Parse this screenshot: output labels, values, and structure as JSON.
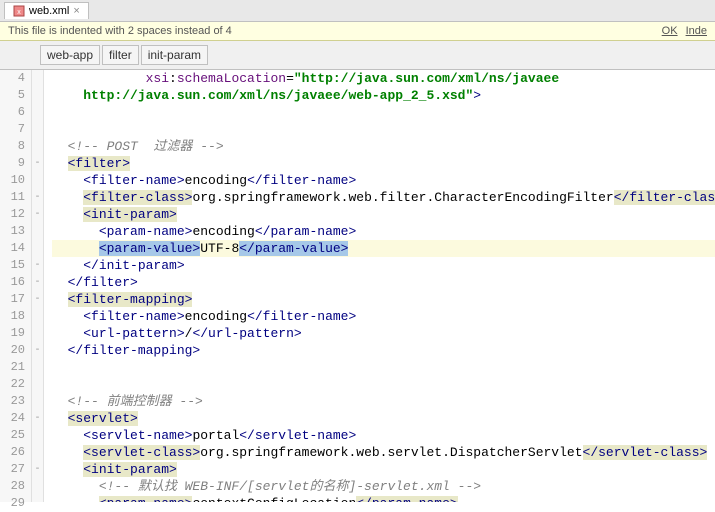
{
  "tab": {
    "filename": "web.xml",
    "close": "×"
  },
  "notice": {
    "text": "This file is indented with 2 spaces instead of 4",
    "ok": "OK",
    "inde": "Inde"
  },
  "breadcrumb": [
    "web-app",
    "filter",
    "init-param"
  ],
  "gutter_start": 4,
  "gutter_end": 29,
  "fold_marks": {
    "9": "-",
    "11": "-",
    "12": "-",
    "15": "-",
    "16": "-",
    "17": "-",
    "20": "-",
    "24": "-",
    "27": "-"
  },
  "code": {
    "4": {
      "indent": 6,
      "parts": [
        [
          "attr",
          "xsi"
        ],
        [
          "txt",
          ":"
        ],
        [
          "attr",
          "schemaLocation"
        ],
        [
          "txt",
          "="
        ],
        [
          "str",
          "\"http://java.sun.com/xml/ns/javaee"
        ]
      ]
    },
    "5": {
      "indent": 2,
      "parts": [
        [
          "str",
          "http://java.sun.com/xml/ns/javaee/web-app_2_5.xsd\""
        ],
        [
          "tag",
          ">"
        ]
      ]
    },
    "6": {
      "indent": 0,
      "parts": []
    },
    "7": {
      "indent": 0,
      "parts": []
    },
    "8": {
      "indent": 1,
      "parts": [
        [
          "cmt",
          "<!-- POST  过滤器 -->"
        ]
      ]
    },
    "9": {
      "indent": 1,
      "hl": true,
      "parts": [
        [
          "tag",
          "<filter>"
        ]
      ]
    },
    "10": {
      "indent": 2,
      "parts": [
        [
          "tag",
          "<filter-name>"
        ],
        [
          "txt",
          "encoding"
        ],
        [
          "tag",
          "</filter-name>"
        ]
      ]
    },
    "11": {
      "indent": 2,
      "hl": true,
      "parts": [
        [
          "tag",
          "<filter-class>"
        ],
        [
          "txt",
          "org.springframework.web.filter.CharacterEncodingFilter"
        ],
        [
          "tag",
          "</filter-class>"
        ]
      ]
    },
    "12": {
      "indent": 2,
      "hl": true,
      "parts": [
        [
          "tag",
          "<init-param>"
        ]
      ]
    },
    "13": {
      "indent": 3,
      "parts": [
        [
          "tag",
          "<param-name>"
        ],
        [
          "txt",
          "encoding"
        ],
        [
          "tag",
          "</param-name>"
        ]
      ]
    },
    "14": {
      "indent": 3,
      "cur": true,
      "sel": true,
      "parts": [
        [
          "tag",
          "<param-value>"
        ],
        [
          "txt",
          "UTF-8"
        ],
        [
          "tag",
          "</param-value>"
        ]
      ]
    },
    "15": {
      "indent": 2,
      "parts": [
        [
          "tag",
          "</init-param>"
        ]
      ]
    },
    "16": {
      "indent": 1,
      "parts": [
        [
          "tag",
          "</filter>"
        ]
      ]
    },
    "17": {
      "indent": 1,
      "hl": true,
      "parts": [
        [
          "tag",
          "<filter-mapping>"
        ]
      ]
    },
    "18": {
      "indent": 2,
      "parts": [
        [
          "tag",
          "<filter-name>"
        ],
        [
          "txt",
          "encoding"
        ],
        [
          "tag",
          "</filter-name>"
        ]
      ]
    },
    "19": {
      "indent": 2,
      "parts": [
        [
          "tag",
          "<url-pattern>"
        ],
        [
          "txt",
          "/"
        ],
        [
          "tag",
          "</url-pattern>"
        ]
      ]
    },
    "20": {
      "indent": 1,
      "parts": [
        [
          "tag",
          "</filter-mapping>"
        ]
      ]
    },
    "21": {
      "indent": 0,
      "parts": []
    },
    "22": {
      "indent": 0,
      "parts": []
    },
    "23": {
      "indent": 1,
      "parts": [
        [
          "cmt",
          "<!-- 前端控制器 -->"
        ]
      ]
    },
    "24": {
      "indent": 1,
      "hl": true,
      "parts": [
        [
          "tag",
          "<servlet>"
        ]
      ]
    },
    "25": {
      "indent": 2,
      "parts": [
        [
          "tag",
          "<servlet-name>"
        ],
        [
          "txt",
          "portal"
        ],
        [
          "tag",
          "</servlet-name>"
        ]
      ]
    },
    "26": {
      "indent": 2,
      "hl": true,
      "parts": [
        [
          "tag",
          "<servlet-class>"
        ],
        [
          "txt",
          "org.springframework.web.servlet.DispatcherServlet"
        ],
        [
          "tag",
          "</servlet-class>"
        ]
      ]
    },
    "27": {
      "indent": 2,
      "hl": true,
      "parts": [
        [
          "tag",
          "<init-param>"
        ]
      ]
    },
    "28": {
      "indent": 3,
      "parts": [
        [
          "cmt",
          "<!-- 默认找 WEB-INF/[servlet的名称]-servlet.xml -->"
        ]
      ]
    },
    "29": {
      "indent": 3,
      "hl": true,
      "parts": [
        [
          "tag",
          "<param-name>"
        ],
        [
          "txt",
          "contextConfigLocation"
        ],
        [
          "tag",
          "</param-name>"
        ]
      ]
    }
  }
}
